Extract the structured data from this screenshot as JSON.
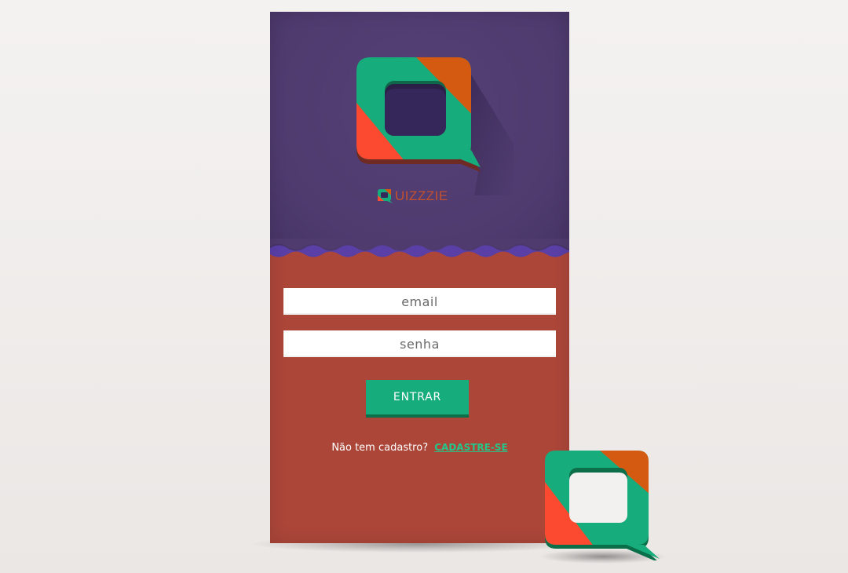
{
  "brand": {
    "name": "UIZZZIE",
    "colors": {
      "purple": "#4f3b6e",
      "wave": "#5a3fa6",
      "red": "#ab4639",
      "green": "#17ac7b",
      "orange": "#d45a12",
      "logo_red": "#fb4a2f"
    }
  },
  "login": {
    "email_placeholder": "email",
    "password_placeholder": "senha",
    "submit_label": "ENTRAR"
  },
  "signup": {
    "prompt": "Não tem cadastro?",
    "link_label": "CADASTRE-SE"
  },
  "icons": {
    "logo": "speech-bubble-logo-icon",
    "small_logo": "speech-bubble-logo-icon"
  }
}
